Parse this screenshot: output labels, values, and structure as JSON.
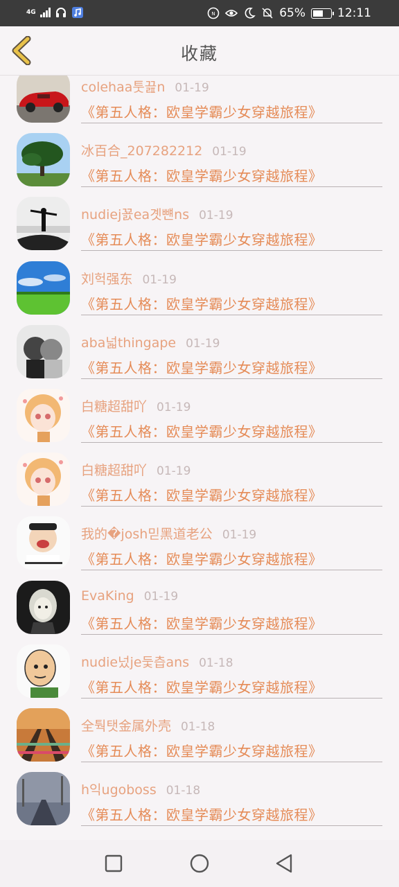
{
  "status": {
    "network": "4G",
    "battery_pct": "65%",
    "time": "12:11",
    "battery_level": 0.65
  },
  "header": {
    "title": "收藏"
  },
  "items": [
    {
      "user": "colehaa툿끒n",
      "date": "01-19",
      "book": "《第五人格：欧皇学霸少女穿越旅程》",
      "avatar": "red-car"
    },
    {
      "user": "冰百合_207282212",
      "date": "01-19",
      "book": "《第五人格：欧皇学霸少女穿越旅程》",
      "avatar": "tree"
    },
    {
      "user": "nudiej꾨ea곗뺸ns",
      "date": "01-19",
      "book": "《第五人格：欧皇学霸少女穿越旅程》",
      "avatar": "person-sea"
    },
    {
      "user": "刘헉强东",
      "date": "01-19",
      "book": "《第五人格：欧皇学霸少女穿越旅程》",
      "avatar": "meadow"
    },
    {
      "user": "aba넓thingape",
      "date": "01-19",
      "book": "《第五人格：欧皇学霸少女穿越旅程》",
      "avatar": "couple"
    },
    {
      "user": "白糖超甜吖",
      "date": "01-19",
      "book": "《第五人格：欧皇学霸少女穿越旅程》",
      "avatar": "anime-girl"
    },
    {
      "user": "白糖超甜吖",
      "date": "01-19",
      "book": "《第五人格：欧皇学霸少女穿越旅程》",
      "avatar": "anime-girl"
    },
    {
      "user": "我的�josh믿黑道老公",
      "date": "01-19",
      "book": "《第五人格：欧皇学霸少女穿越旅程》",
      "avatar": "cartoon-crying"
    },
    {
      "user": "EvaKing",
      "date": "01-19",
      "book": "《第五人格：欧皇学霸少女穿越旅程》",
      "avatar": "dark-girl"
    },
    {
      "user": "nudie넜je둧츱ans",
      "date": "01-18",
      "book": "《第五人格：欧皇学霸少女穿越旅程》",
      "avatar": "bald-cartoon"
    },
    {
      "user": "全퉉탯金属外壳",
      "date": "01-18",
      "book": "《第五人格：欧皇学霸少女穿越旅程》",
      "avatar": "rail-track"
    },
    {
      "user": "h익ugoboss",
      "date": "01-18",
      "book": "《第五人格：欧皇学霸少女穿越旅程》",
      "avatar": "misty-path"
    }
  ]
}
